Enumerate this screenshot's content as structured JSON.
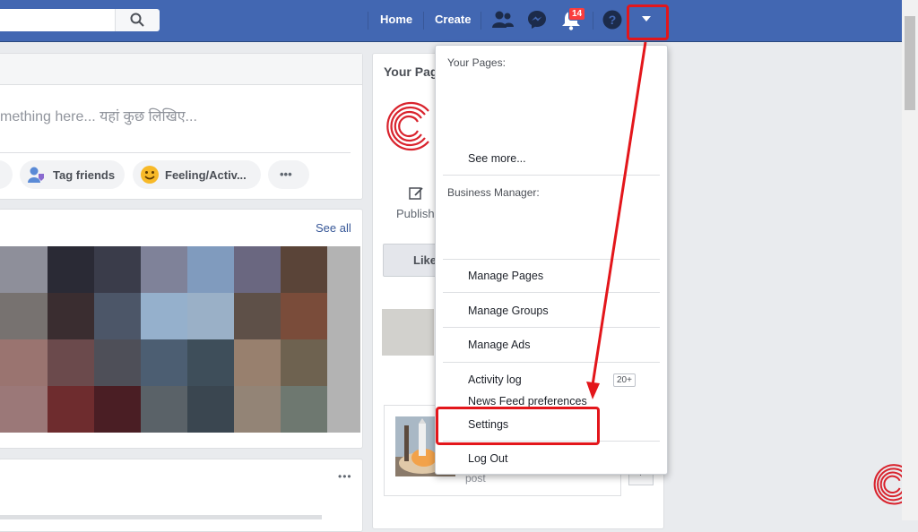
{
  "topbar": {
    "home_label": "Home",
    "create_label": "Create",
    "notification_count": "14"
  },
  "composer": {
    "placeholder": "mething here... यहां कुछ लिखिए...",
    "tag_friends_label": "Tag friends",
    "feeling_label": "Feeling/Activ...",
    "more_label": "•••"
  },
  "photos": {
    "see_all_label": "See all",
    "mosaic_colors": [
      "#8e8f9a",
      "#2a2a35",
      "#3a3c4a",
      "#7f8299",
      "#809bbe",
      "#6a6780",
      "#5a4438",
      "#b3b3b3",
      "#777270",
      "#3a2d30",
      "#4c5668",
      "#95b0cc",
      "#9ab0c7",
      "#5e5048",
      "#7a4c3a",
      "#b3b3b3",
      "#9a7470",
      "#6b4a4c",
      "#4e4f58",
      "#4c5e72",
      "#3e4e5a",
      "#98806e",
      "#6e6250",
      "#b3b3b3",
      "#9b7878",
      "#6e2c2e",
      "#4a1e24",
      "#5a6268",
      "#3a4650",
      "#938476",
      "#6e7870",
      "#b3b3b3"
    ]
  },
  "right_panel": {
    "title": "Your Pag",
    "publish_label": "Publish",
    "like_label": "Like",
    "post_label": "post"
  },
  "menu": {
    "your_pages_heading": "Your Pages:",
    "see_more_label": "See more...",
    "business_manager_heading": "Business Manager:",
    "items": [
      {
        "label": "Manage Pages"
      },
      {
        "label": "Manage Groups"
      },
      {
        "label": "Manage Ads"
      },
      {
        "label": "Activity log"
      },
      {
        "label": "News Feed preferences"
      },
      {
        "label": "Settings"
      },
      {
        "label": "Log Out"
      }
    ],
    "activity_count": "20+"
  },
  "annotation": {
    "color": "#e3161b"
  }
}
